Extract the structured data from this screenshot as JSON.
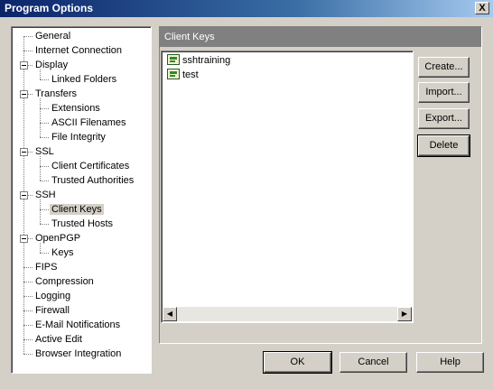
{
  "window": {
    "title": "Program Options",
    "close_label": "X"
  },
  "tree": {
    "items": [
      {
        "label": "General",
        "level": 0,
        "expandable": false
      },
      {
        "label": "Internet Connection",
        "level": 0,
        "expandable": false
      },
      {
        "label": "Display",
        "level": 0,
        "expandable": true
      },
      {
        "label": "Linked Folders",
        "level": 1,
        "expandable": false
      },
      {
        "label": "Transfers",
        "level": 0,
        "expandable": true
      },
      {
        "label": "Extensions",
        "level": 1,
        "expandable": false
      },
      {
        "label": "ASCII Filenames",
        "level": 1,
        "expandable": false
      },
      {
        "label": "File Integrity",
        "level": 1,
        "expandable": false
      },
      {
        "label": "SSL",
        "level": 0,
        "expandable": true
      },
      {
        "label": "Client Certificates",
        "level": 1,
        "expandable": false
      },
      {
        "label": "Trusted Authorities",
        "level": 1,
        "expandable": false
      },
      {
        "label": "SSH",
        "level": 0,
        "expandable": true
      },
      {
        "label": "Client Keys",
        "level": 1,
        "expandable": false,
        "selected": true
      },
      {
        "label": "Trusted Hosts",
        "level": 1,
        "expandable": false
      },
      {
        "label": "OpenPGP",
        "level": 0,
        "expandable": true
      },
      {
        "label": "Keys",
        "level": 1,
        "expandable": false
      },
      {
        "label": "FIPS",
        "level": 0,
        "expandable": false
      },
      {
        "label": "Compression",
        "level": 0,
        "expandable": false
      },
      {
        "label": "Logging",
        "level": 0,
        "expandable": false
      },
      {
        "label": "Firewall",
        "level": 0,
        "expandable": false
      },
      {
        "label": "E-Mail Notifications",
        "level": 0,
        "expandable": false
      },
      {
        "label": "Active Edit",
        "level": 0,
        "expandable": false
      },
      {
        "label": "Browser Integration",
        "level": 0,
        "expandable": false
      }
    ]
  },
  "panel": {
    "header": "Client Keys",
    "keys": [
      "sshtraining",
      "test"
    ],
    "scroll_left": "◀",
    "scroll_right": "▶"
  },
  "actions": {
    "create": "Create...",
    "import": "Import...",
    "export": "Export...",
    "delete": "Delete"
  },
  "footer": {
    "ok": "OK",
    "cancel": "Cancel",
    "help": "Help"
  }
}
